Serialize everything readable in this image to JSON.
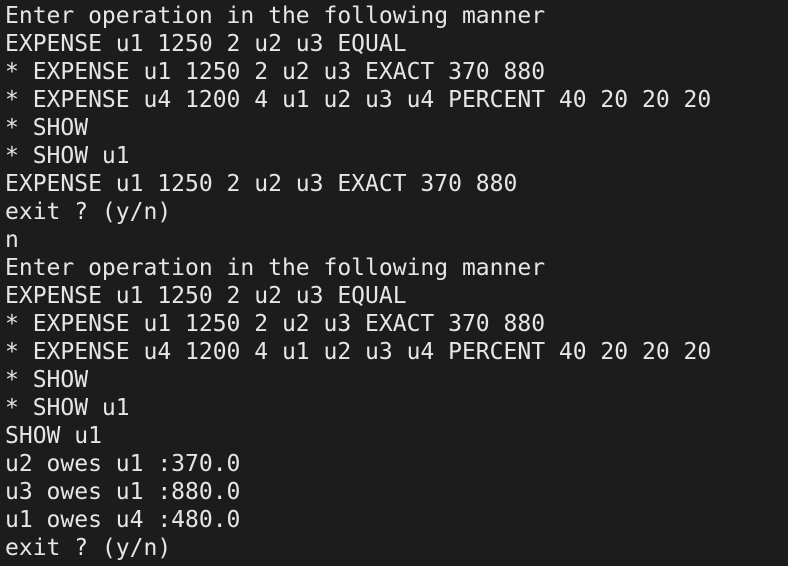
{
  "terminal": {
    "lines": [
      "Enter operation in the following manner",
      "EXPENSE u1 1250 2 u2 u3 EQUAL",
      "* EXPENSE u1 1250 2 u2 u3 EXACT 370 880",
      "* EXPENSE u4 1200 4 u1 u2 u3 u4 PERCENT 40 20 20 20",
      "* SHOW",
      "* SHOW u1",
      "EXPENSE u1 1250 2 u2 u3 EXACT 370 880",
      "exit ? (y/n)",
      "n",
      "Enter operation in the following manner",
      "EXPENSE u1 1250 2 u2 u3 EQUAL",
      "* EXPENSE u1 1250 2 u2 u3 EXACT 370 880",
      "* EXPENSE u4 1200 4 u1 u2 u3 u4 PERCENT 40 20 20 20",
      "* SHOW",
      "* SHOW u1",
      "SHOW u1",
      "u2 owes u1 :370.0",
      "u3 owes u1 :880.0",
      "u1 owes u4 :480.0",
      "exit ? (y/n)"
    ]
  },
  "colors": {
    "background": "#1c1c1c",
    "foreground": "#e6e6e6"
  }
}
